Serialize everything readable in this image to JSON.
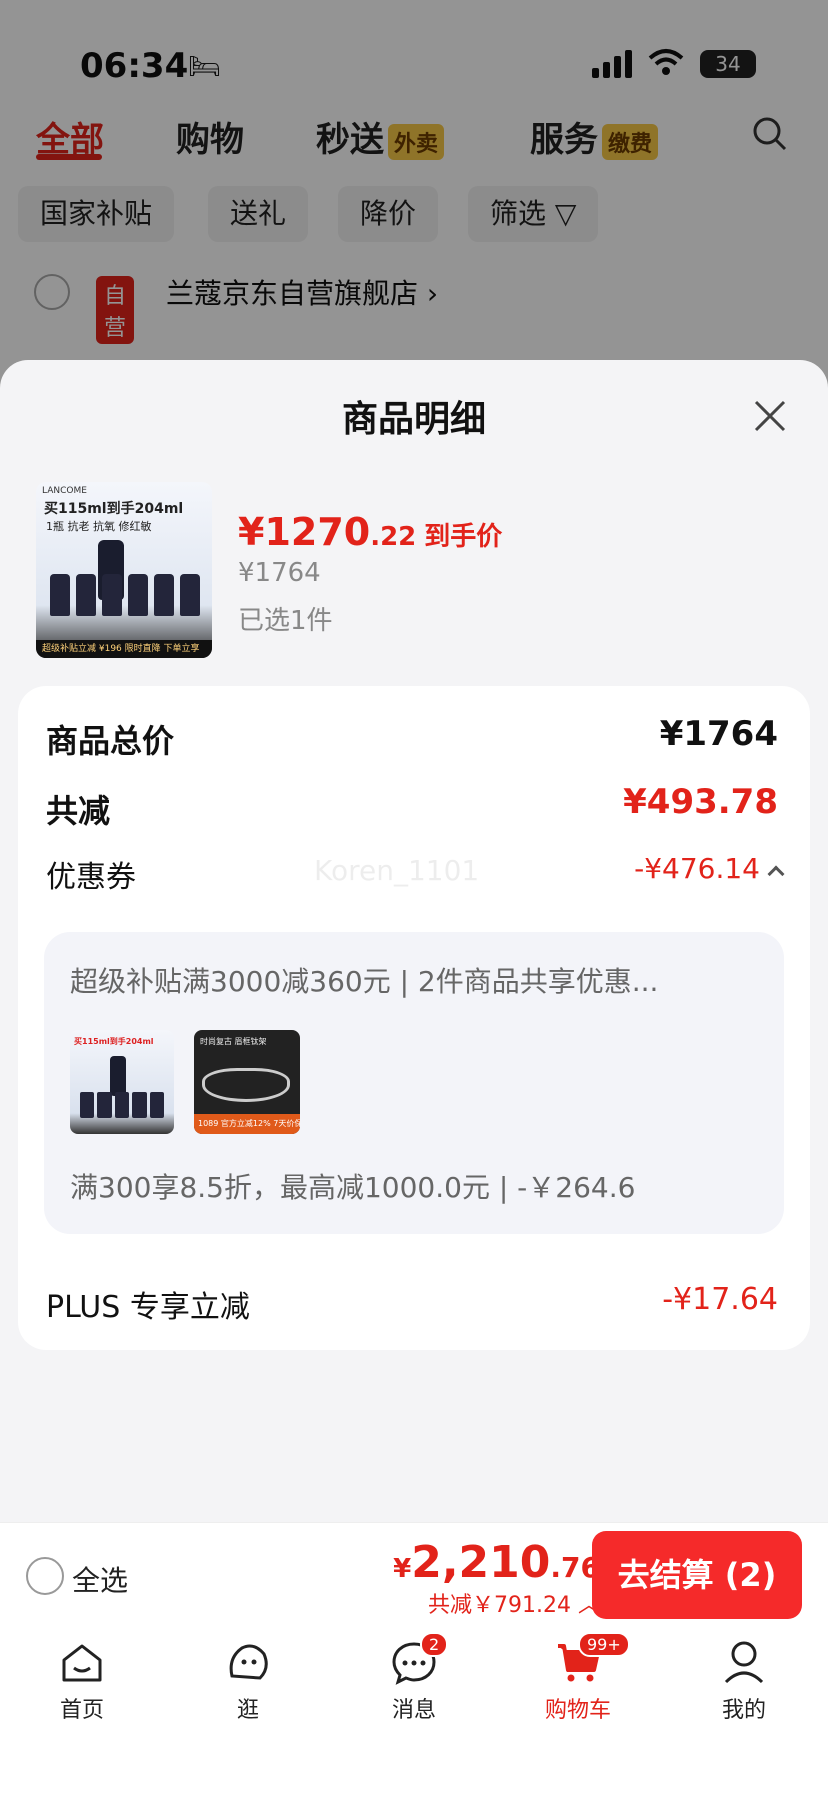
{
  "status_bar": {
    "time": "06:34",
    "battery": "34"
  },
  "top_tabs": [
    {
      "label": "全部",
      "active": true
    },
    {
      "label": "购物"
    },
    {
      "label": "秒送",
      "badge": "外卖"
    },
    {
      "label": "服务",
      "badge": "缴费"
    }
  ],
  "filter_chips": [
    "国家补贴",
    "送礼",
    "降价",
    "筛选"
  ],
  "shop": {
    "tag": "自营",
    "name": "兰蔻京东自营旗舰店"
  },
  "sheet": {
    "title": "商品明细",
    "product": {
      "image_brand": "LANCOME",
      "image_headline": "买115ml到手204ml",
      "image_subline": "1瓶 抗老 抗氧 修红敏",
      "image_banner": "超级补贴立减 ¥196  限时直降 下单立享",
      "price_int": "¥1270",
      "price_dec": ".22",
      "price_tag": "到手价",
      "original_price": "¥1764",
      "selected": "已选1件"
    },
    "breakdown": {
      "total_label": "商品总价",
      "total_value": "¥1764",
      "reduce_label": "共减",
      "reduce_value": "¥493.78",
      "watermark": "Koren_1101",
      "coupon_label": "优惠券",
      "coupon_value": "-¥476.14",
      "coupon_box": {
        "title": "超级补贴满3000减360元 | 2件商品共享优惠...",
        "img1_text": "买115ml到手204ml",
        "img2_text": "时尚复古 眉框钛架",
        "img2_banner": "1089  官方立减12%  7天价保",
        "desc": "满300享8.5折，最高减1000.0元 | -￥264.6"
      },
      "plus_label": "PLUS 专享立减",
      "plus_value": "-¥17.64"
    }
  },
  "checkout": {
    "select_all": "全选",
    "currency": "¥",
    "total_int": "2,210",
    "total_dec": ".76",
    "saving": "共减￥791.24",
    "pay_button": "去结算 (2)"
  },
  "tabbar": [
    {
      "label": "首页",
      "icon": "home-icon"
    },
    {
      "label": "逛",
      "icon": "explore-icon"
    },
    {
      "label": "消息",
      "icon": "message-icon",
      "badge": "2"
    },
    {
      "label": "购物车",
      "icon": "cart-icon",
      "badge": "99+",
      "active": true
    },
    {
      "label": "我的",
      "icon": "profile-icon"
    }
  ],
  "colors": {
    "accent": "#e2231a",
    "button": "#f52a2a",
    "sheet_bg": "#f4f4f6"
  }
}
